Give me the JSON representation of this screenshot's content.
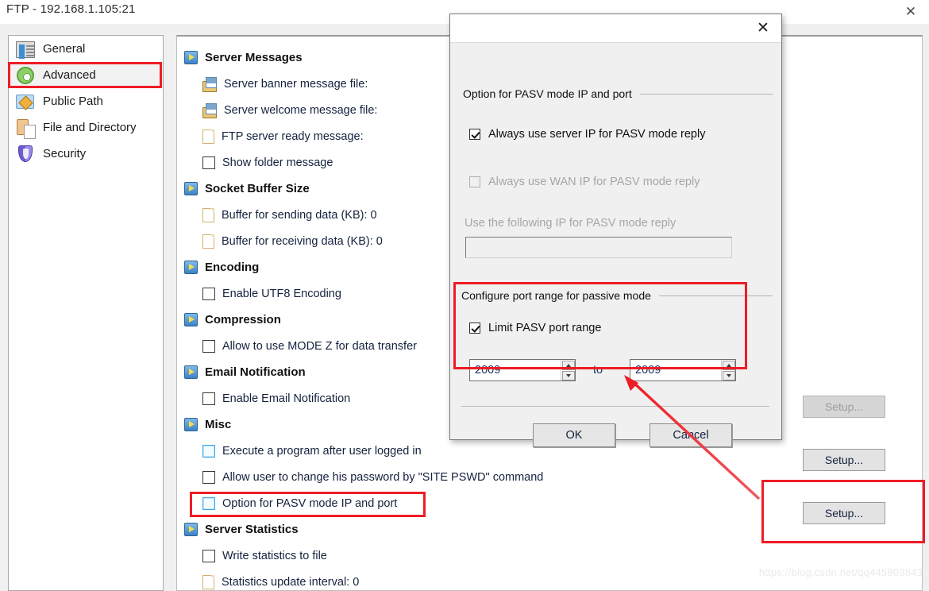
{
  "window": {
    "title": "FTP - 192.168.1.105:21",
    "close_icon": "close-icon",
    "close_glyph": "✕"
  },
  "sidebar": {
    "items": [
      {
        "label": "General",
        "icon": "document-columns-icon",
        "selected": false
      },
      {
        "label": "Advanced",
        "icon": "gear-icon",
        "selected": true
      },
      {
        "label": "Public Path",
        "icon": "folder-shared-icon",
        "selected": false
      },
      {
        "label": "File and Directory",
        "icon": "clipboard-file-icon",
        "selected": false
      },
      {
        "label": "Security",
        "icon": "shield-icon",
        "selected": false
      }
    ]
  },
  "content": {
    "rows": [
      {
        "type": "group",
        "label": "Server Messages",
        "icon": "play-group-icon"
      },
      {
        "type": "file",
        "label": "Server banner message file:",
        "icon": "message-file-icon"
      },
      {
        "type": "file",
        "label": "Server welcome message file:",
        "icon": "message-file-icon"
      },
      {
        "type": "doc",
        "label": "FTP server ready message:",
        "icon": "document-icon"
      },
      {
        "type": "check",
        "label": "Show folder message",
        "checked": false,
        "highlight": false
      },
      {
        "type": "group",
        "label": "Socket Buffer Size",
        "icon": "play-group-icon"
      },
      {
        "type": "doc",
        "label": "Buffer for sending data (KB): 0",
        "icon": "document-icon"
      },
      {
        "type": "doc",
        "label": "Buffer for receiving data (KB): 0",
        "icon": "document-icon"
      },
      {
        "type": "group",
        "label": "Encoding",
        "icon": "play-group-icon"
      },
      {
        "type": "check",
        "label": "Enable UTF8 Encoding",
        "checked": false,
        "highlight": false
      },
      {
        "type": "group",
        "label": "Compression",
        "icon": "play-group-icon"
      },
      {
        "type": "check",
        "label": "Allow to use MODE Z for data transfer",
        "checked": false,
        "highlight": false
      },
      {
        "type": "group",
        "label": "Email Notification",
        "icon": "play-group-icon"
      },
      {
        "type": "check",
        "label": "Enable Email Notification",
        "checked": false,
        "highlight": false
      },
      {
        "type": "group",
        "label": "Misc",
        "icon": "play-group-icon"
      },
      {
        "type": "check",
        "label": "Execute a program after user logged in",
        "checked": false,
        "highlight": true
      },
      {
        "type": "check",
        "label": "Allow user to change his password by \"SITE PSWD\" command",
        "checked": false,
        "highlight": false
      },
      {
        "type": "check",
        "label": "Option for PASV mode IP and port",
        "checked": false,
        "highlight": true
      },
      {
        "type": "group",
        "label": "Server Statistics",
        "icon": "play-group-icon"
      },
      {
        "type": "check",
        "label": "Write statistics to file",
        "checked": false,
        "highlight": false
      },
      {
        "type": "doc",
        "label": "Statistics update interval: 0",
        "icon": "document-icon"
      }
    ],
    "setup_buttons": [
      {
        "label": "Setup...",
        "disabled": true
      },
      {
        "label": "Setup...",
        "disabled": false
      },
      {
        "label": "Setup...",
        "disabled": false
      }
    ]
  },
  "dialog": {
    "close_glyph": "✕",
    "group1_title": "Option for PASV mode IP and port",
    "group2_title": "Configure port range for passive mode",
    "checkbox_server_ip": {
      "label": "Always use server IP for PASV mode reply",
      "checked": true,
      "disabled": false
    },
    "checkbox_wan_ip": {
      "label": "Always use WAN IP for PASV mode reply",
      "checked": false,
      "disabled": true
    },
    "ip_label": "Use the following IP for PASV mode reply",
    "ip_value": "",
    "checkbox_limit_range": {
      "label": "Limit PASV port range",
      "checked": true,
      "disabled": false
    },
    "port_from": "2009",
    "port_to": "2009",
    "to_label": "to",
    "ok_label": "OK",
    "cancel_label": "Cancel",
    "spinner_up_icon": "spinner-up-arrow-icon",
    "spinner_down_icon": "spinner-down-arrow-icon"
  },
  "annotations": {
    "highlight_color": "#ee1c25",
    "boxes": [
      {
        "name": "advanced-sidebar-highlight"
      },
      {
        "name": "pasv-option-row-highlight"
      },
      {
        "name": "limit-pasv-port-range-highlight"
      },
      {
        "name": "setup-button-highlight"
      }
    ],
    "arrow": {
      "name": "callout-arrow",
      "from": "setup-button",
      "to": "port-range-group"
    }
  },
  "watermark": {
    "text": "https://blog.csdn.net/qq445803843"
  }
}
